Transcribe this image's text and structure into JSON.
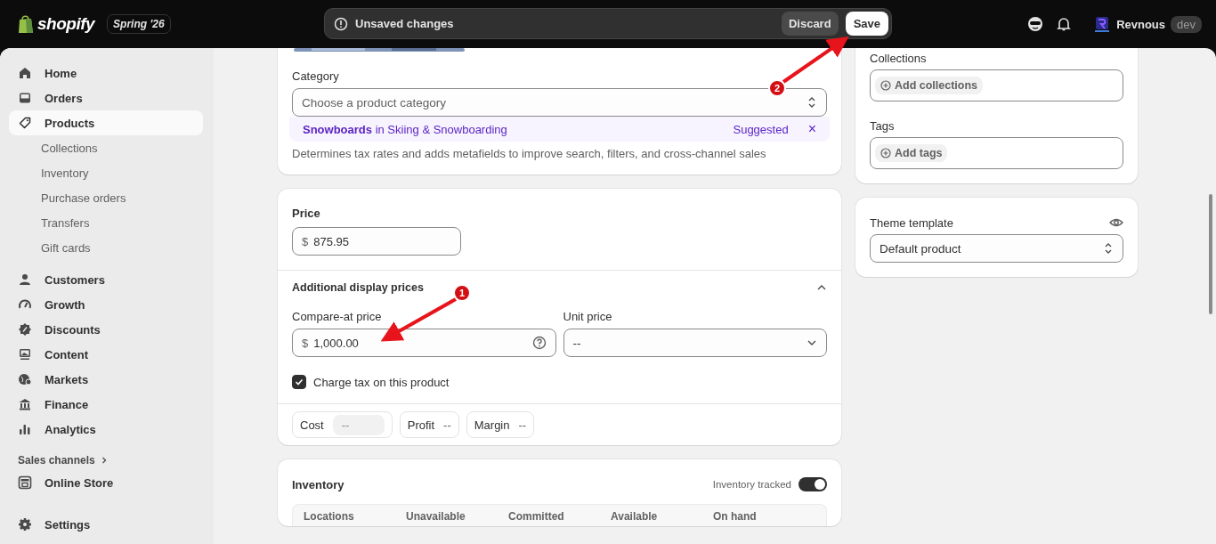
{
  "topbar": {
    "logo_text": "shopify",
    "edition": "Spring '26",
    "notice": "Unsaved changes",
    "discard": "Discard",
    "save": "Save",
    "store": "Revnous",
    "store_badge": "dev"
  },
  "sidebar": {
    "items": [
      {
        "label": "Home",
        "selected": false
      },
      {
        "label": "Orders",
        "selected": false
      },
      {
        "label": "Products",
        "selected": true,
        "children": [
          {
            "label": "Collections",
            "selected": false
          },
          {
            "label": "Inventory",
            "selected": false
          },
          {
            "label": "Purchase orders",
            "selected": false
          },
          {
            "label": "Transfers",
            "selected": false
          },
          {
            "label": "Gift cards",
            "selected": false
          }
        ]
      },
      {
        "label": "Customers",
        "selected": false
      },
      {
        "label": "Growth",
        "selected": false
      },
      {
        "label": "Discounts",
        "selected": false
      },
      {
        "label": "Content",
        "selected": false
      },
      {
        "label": "Markets",
        "selected": false
      },
      {
        "label": "Finance",
        "selected": false
      },
      {
        "label": "Analytics",
        "selected": false
      }
    ],
    "sales_channels": {
      "heading": "Sales channels",
      "items": [
        {
          "label": "Online Store",
          "selected": false
        }
      ]
    },
    "settings": "Settings"
  },
  "category": {
    "label": "Category",
    "placeholder": "Choose a product category",
    "suggestion": "**Snowboards** in Skiing & Snowboarding",
    "suggested": "Suggested",
    "dismiss": "×",
    "help": "Determines tax rates and adds metafields to improve search, filters, and cross-channel sales"
  },
  "pricing": {
    "label": "Price",
    "currency": "$",
    "value": "875.95",
    "additional": "Additional display prices",
    "expanded": true,
    "compare_at": {
      "label": "Compare-at price",
      "currency": "$",
      "value": "1,000.00"
    },
    "unit_price": {
      "label": "Unit price",
      "value": "--"
    },
    "charge_tax": {
      "label": "Charge tax on this product",
      "checked": true
    },
    "metrics": [
      {
        "label": "Cost",
        "placeholder": "--",
        "kind": "field"
      },
      {
        "label": "Profit",
        "value": "--",
        "kind": "text"
      },
      {
        "label": "Margin",
        "value": "--",
        "kind": "text"
      }
    ]
  },
  "inventory": {
    "title": "Inventory",
    "tracked_label": "Inventory tracked",
    "tracked": true,
    "columns": [
      "Locations",
      "Unavailable",
      "Committed",
      "Available",
      "On hand"
    ]
  },
  "organization": {
    "collections": {
      "label": "Collections",
      "button": "Add collections"
    },
    "tags": {
      "label": "Tags",
      "button": "Add tags"
    }
  },
  "theme_template": {
    "label": "Theme template",
    "value": "Default product"
  },
  "annotations": [
    {
      "number": "1"
    },
    {
      "number": "2"
    }
  ]
}
